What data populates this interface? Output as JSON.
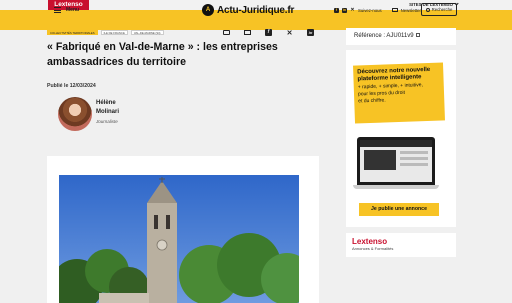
{
  "topbar": {
    "brand": "Lextenso",
    "sites_label": "SITES DE LEXTENSO"
  },
  "header": {
    "menu_label": "Menu",
    "logo_text": "Actu-Juridique.fr",
    "social": [
      "facebook-icon",
      "linkedin-icon",
      "x-icon"
    ],
    "follow_label": "Suivez-nous",
    "newsletter_label": "Newsletter",
    "search_label": "Recherche",
    "accent_color": "#f7c325",
    "brand_color": "#c8102e"
  },
  "article": {
    "tags": [
      "COLLECTIVITÉS TERRITORIALES",
      "ILE DE FRANCE",
      "VAL-DE-MARNE (94)"
    ],
    "title": "« Fabriqué en Val-de-Marne » : les entreprises ambassadrices du territoire",
    "published": "Publié le 12/03/2024",
    "author_name": "Hélène Molinari",
    "author_role": "Journaliste"
  },
  "sidebar": {
    "reference": "Référence : AJU011v9",
    "ad_headline": "Découvrez notre nouvelle plateforme intelligente",
    "ad_lines": [
      "+ rapide, + simple, + intuitive,",
      "pour les pros du droit",
      "et du chiffre."
    ],
    "ad_button": "Je publie une annonce",
    "lextenso_name": "Lextenso",
    "lextenso_sub": "Annonces & Formalités"
  }
}
